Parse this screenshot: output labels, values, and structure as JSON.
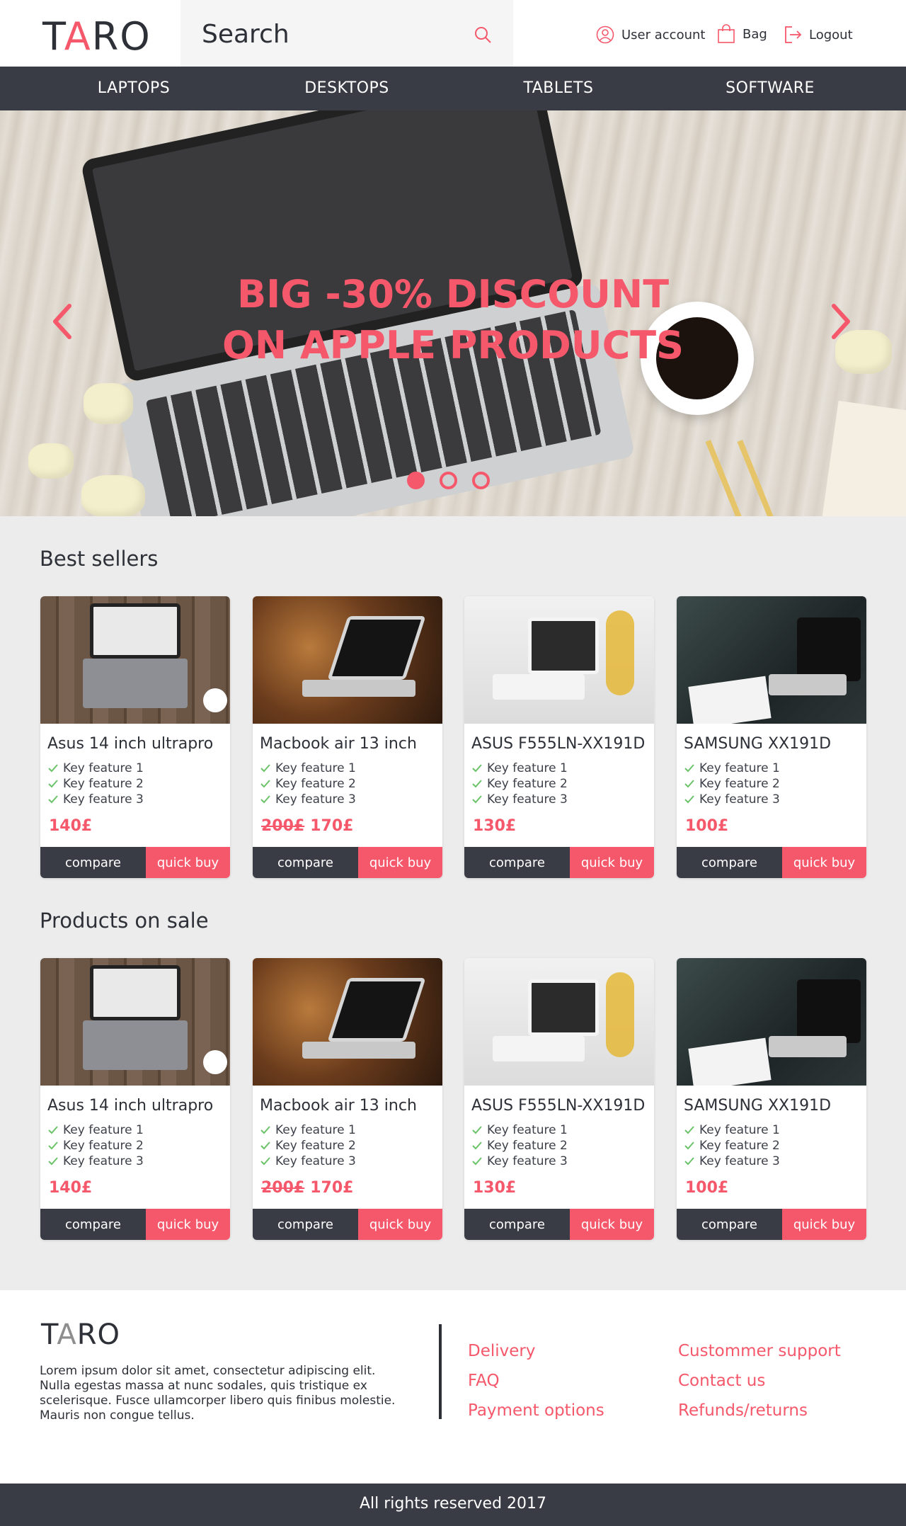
{
  "header": {
    "logo": "TARO",
    "search_label": "Search",
    "user_account": "User account",
    "bag": "Bag",
    "logout": "Logout"
  },
  "nav": [
    "LAPTOPS",
    "DESKTOPS",
    "TABLETS",
    "SOFTWARE"
  ],
  "hero": {
    "line1": "BIG -30% DISCOUNT",
    "line2": "ON APPLE PRODUCTS",
    "active_slide": 1,
    "slide_count": 3
  },
  "best_sellers": {
    "title": "Best sellers",
    "products": [
      {
        "name": "Asus 14 inch ultrapro",
        "features": [
          "Key feature 1",
          "Key feature 2",
          "Key feature 3"
        ],
        "old_price": "",
        "price": "140£"
      },
      {
        "name": "Macbook air 13 inch",
        "features": [
          "Key feature 1",
          "Key feature 2",
          "Key feature 3"
        ],
        "old_price": "200£",
        "price": "170£"
      },
      {
        "name": "ASUS F555LN-XX191D",
        "features": [
          "Key feature 1",
          "Key feature 2",
          "Key feature 3"
        ],
        "old_price": "",
        "price": "130£"
      },
      {
        "name": "SAMSUNG XX191D",
        "features": [
          "Key feature 1",
          "Key feature 2",
          "Key feature 3"
        ],
        "old_price": "",
        "price": "100£"
      }
    ]
  },
  "on_sale": {
    "title": "Products on sale",
    "products": [
      {
        "name": "Asus 14 inch ultrapro",
        "features": [
          "Key feature 1",
          "Key feature 2",
          "Key feature 3"
        ],
        "old_price": "",
        "price": "140£"
      },
      {
        "name": "Macbook air 13 inch",
        "features": [
          "Key feature 1",
          "Key feature 2",
          "Key feature 3"
        ],
        "old_price": "200£",
        "price": "170£"
      },
      {
        "name": "ASUS F555LN-XX191D",
        "features": [
          "Key feature 1",
          "Key feature 2",
          "Key feature 3"
        ],
        "old_price": "",
        "price": "130£"
      },
      {
        "name": "SAMSUNG XX191D",
        "features": [
          "Key feature 1",
          "Key feature 2",
          "Key feature 3"
        ],
        "old_price": "",
        "price": "100£"
      }
    ]
  },
  "buttons": {
    "compare": "compare",
    "quick_buy": "quick buy"
  },
  "footer": {
    "logo": "TARO",
    "text": "Lorem ipsum dolor sit amet, consectetur adipiscing elit. Nulla egestas massa at nunc sodales, quis tristique ex scelerisque. Fusce ullamcorper libero quis finibus molestie. Mauris non congue tellus.",
    "links_left": [
      "Delivery",
      "FAQ",
      "Payment options"
    ],
    "links_right": [
      "Custommer support",
      "Contact us",
      "Refunds/returns"
    ],
    "copyright": "All rights reserved 2017"
  },
  "colors": {
    "accent": "#f5586b",
    "dark": "#393c45",
    "background": "#ececec",
    "check": "#6cc36a"
  },
  "icons": [
    "search-icon",
    "user-icon",
    "bag-icon",
    "logout-icon",
    "chevron-left-icon",
    "chevron-right-icon",
    "check-icon"
  ]
}
